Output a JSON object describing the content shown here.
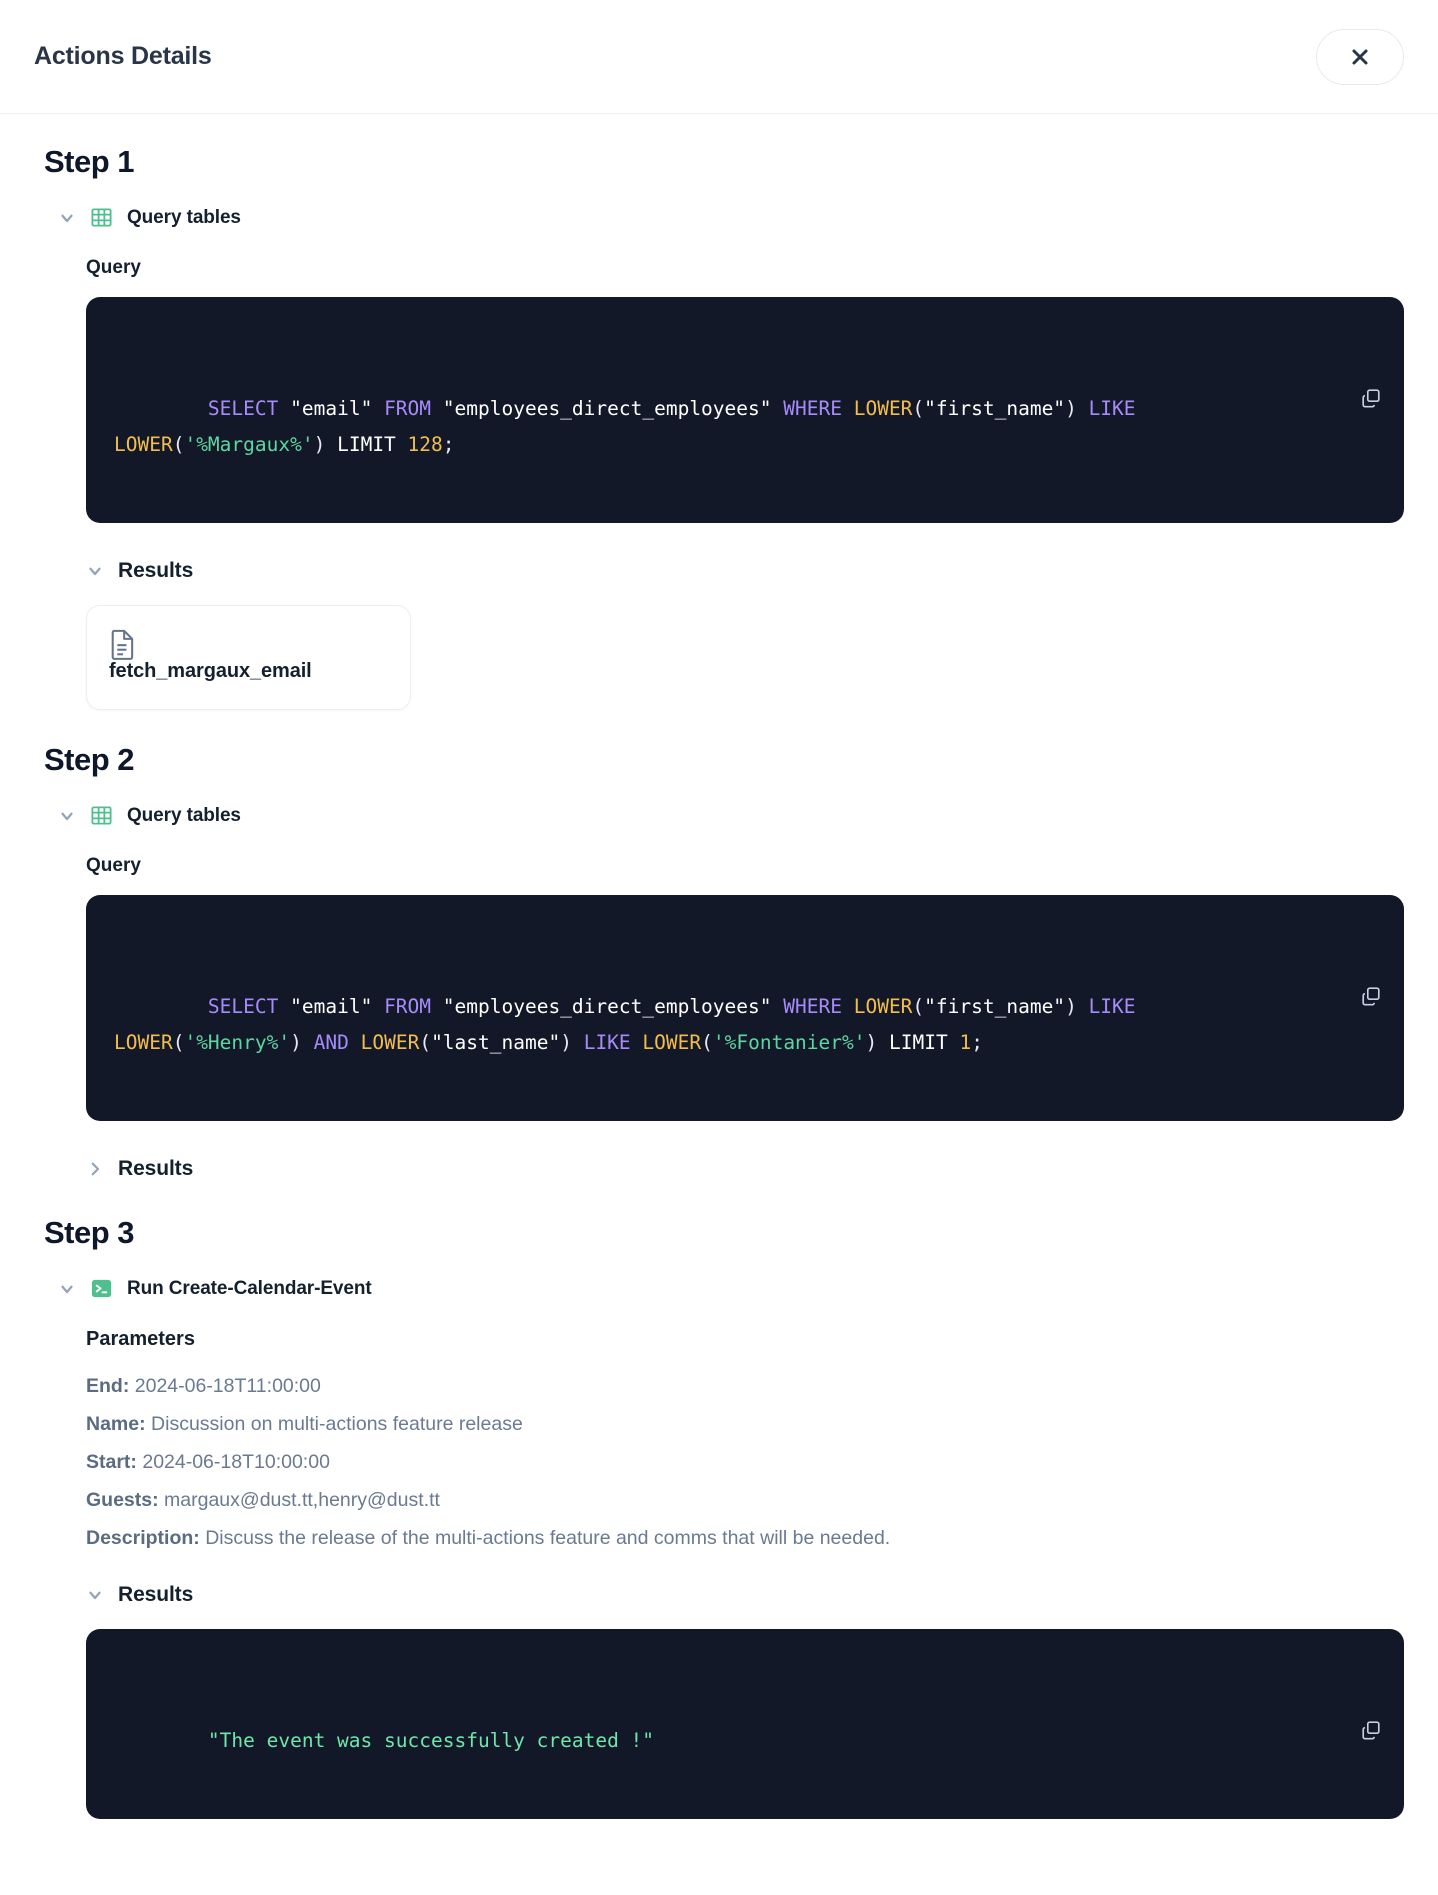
{
  "header": {
    "title": "Actions Details",
    "close_icon": "close-icon"
  },
  "steps": [
    {
      "title": "Step 1",
      "action": {
        "icon": "table-grid-icon",
        "label": "Query tables",
        "chevron": "chevron-down-icon"
      },
      "query_label": "Query",
      "query_tokens": [
        {
          "t": "SELECT",
          "c": "kw"
        },
        {
          "t": " ",
          "c": "pl"
        },
        {
          "t": "\"email\"",
          "c": "str"
        },
        {
          "t": " ",
          "c": "pl"
        },
        {
          "t": "FROM",
          "c": "kw"
        },
        {
          "t": " ",
          "c": "pl"
        },
        {
          "t": "\"employees_direct_employees\"",
          "c": "str"
        },
        {
          "t": " ",
          "c": "pl"
        },
        {
          "t": "WHERE",
          "c": "kw"
        },
        {
          "t": " ",
          "c": "pl"
        },
        {
          "t": "LOWER",
          "c": "fn"
        },
        {
          "t": "(",
          "c": "pl"
        },
        {
          "t": "\"first_name\"",
          "c": "str"
        },
        {
          "t": ")",
          "c": "pl"
        },
        {
          "t": " ",
          "c": "pl"
        },
        {
          "t": "LIKE",
          "c": "kw"
        },
        {
          "t": " ",
          "c": "pl"
        },
        {
          "t": "LOWER",
          "c": "fn"
        },
        {
          "t": "(",
          "c": "pl"
        },
        {
          "t": "'%Margaux%'",
          "c": "sq"
        },
        {
          "t": ")",
          "c": "pl"
        },
        {
          "t": " ",
          "c": "pl"
        },
        {
          "t": "LIMIT",
          "c": "str"
        },
        {
          "t": " ",
          "c": "pl"
        },
        {
          "t": "128",
          "c": "num"
        },
        {
          "t": ";",
          "c": "pl"
        }
      ],
      "query_plain": "SELECT \"email\" FROM \"employees_direct_employees\" WHERE LOWER(\"first_name\") LIKE LOWER('%Margaux%') LIMIT 128;",
      "copy_icon": "copy-icon",
      "results_label": "Results",
      "results_expanded": true,
      "results_chevron": "chevron-down-icon",
      "result_file": {
        "icon": "document-icon",
        "name": "fetch_margaux_email"
      }
    },
    {
      "title": "Step 2",
      "action": {
        "icon": "table-grid-icon",
        "label": "Query tables",
        "chevron": "chevron-down-icon"
      },
      "query_label": "Query",
      "query_tokens": [
        {
          "t": "SELECT",
          "c": "kw"
        },
        {
          "t": " ",
          "c": "pl"
        },
        {
          "t": "\"email\"",
          "c": "str"
        },
        {
          "t": " ",
          "c": "pl"
        },
        {
          "t": "FROM",
          "c": "kw"
        },
        {
          "t": " ",
          "c": "pl"
        },
        {
          "t": "\"employees_direct_employees\"",
          "c": "str"
        },
        {
          "t": " ",
          "c": "pl"
        },
        {
          "t": "WHERE",
          "c": "kw"
        },
        {
          "t": " ",
          "c": "pl"
        },
        {
          "t": "LOWER",
          "c": "fn"
        },
        {
          "t": "(",
          "c": "pl"
        },
        {
          "t": "\"first_name\"",
          "c": "str"
        },
        {
          "t": ")",
          "c": "pl"
        },
        {
          "t": " ",
          "c": "pl"
        },
        {
          "t": "LIKE",
          "c": "kw"
        },
        {
          "t": " ",
          "c": "pl"
        },
        {
          "t": "LOWER",
          "c": "fn"
        },
        {
          "t": "(",
          "c": "pl"
        },
        {
          "t": "'%Henry%'",
          "c": "sq"
        },
        {
          "t": ")",
          "c": "pl"
        },
        {
          "t": " ",
          "c": "pl"
        },
        {
          "t": "AND",
          "c": "kw"
        },
        {
          "t": " ",
          "c": "pl"
        },
        {
          "t": "LOWER",
          "c": "fn"
        },
        {
          "t": "(",
          "c": "pl"
        },
        {
          "t": "\"last_name\"",
          "c": "str"
        },
        {
          "t": ")",
          "c": "pl"
        },
        {
          "t": " ",
          "c": "pl"
        },
        {
          "t": "LIKE",
          "c": "kw"
        },
        {
          "t": " ",
          "c": "pl"
        },
        {
          "t": "LOWER",
          "c": "fn"
        },
        {
          "t": "(",
          "c": "pl"
        },
        {
          "t": "'%Fontanier%'",
          "c": "sq"
        },
        {
          "t": ")",
          "c": "pl"
        },
        {
          "t": " ",
          "c": "pl"
        },
        {
          "t": "LIMIT",
          "c": "str"
        },
        {
          "t": " ",
          "c": "pl"
        },
        {
          "t": "1",
          "c": "num"
        },
        {
          "t": ";",
          "c": "pl"
        }
      ],
      "query_plain": "SELECT \"email\" FROM \"employees_direct_employees\" WHERE LOWER(\"first_name\") LIKE LOWER('%Henry%') AND LOWER(\"last_name\") LIKE LOWER('%Fontanier%') LIMIT 1;",
      "copy_icon": "copy-icon",
      "results_label": "Results",
      "results_expanded": false,
      "results_chevron": "chevron-right-icon"
    },
    {
      "title": "Step 3",
      "action": {
        "icon": "terminal-icon",
        "label": "Run Create-Calendar-Event",
        "chevron": "chevron-down-icon"
      },
      "parameters_title": "Parameters",
      "parameters": [
        {
          "key": "End:",
          "value": "2024-06-18T11:00:00"
        },
        {
          "key": "Name:",
          "value": "Discussion on multi-actions feature release"
        },
        {
          "key": "Start:",
          "value": "2024-06-18T10:00:00"
        },
        {
          "key": "Guests:",
          "value": "margaux@dust.tt,henry@dust.tt"
        },
        {
          "key": "Description:",
          "value": "Discuss the release of the multi-actions feature and comms that will be needed."
        }
      ],
      "results_label": "Results",
      "results_expanded": true,
      "results_chevron": "chevron-down-icon",
      "result_output": "\"The event was successfully created !\"",
      "copy_icon": "copy-icon"
    }
  ],
  "colors": {
    "code_bg": "#131828",
    "keyword": "#a78bfa",
    "function": "#f3bd4e",
    "string": "#ffffff",
    "single_quoted_string": "#5fd6a0",
    "number": "#f3bd4e",
    "success_text": "#6ee7a8",
    "icon_green": "#4fc08d",
    "title": "#2a3547"
  }
}
